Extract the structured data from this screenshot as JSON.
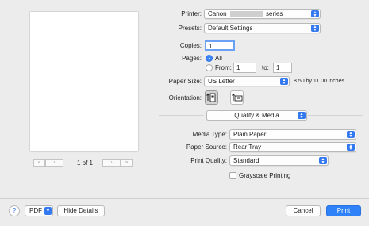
{
  "printer": {
    "label": "Printer:",
    "brand": "Canon",
    "model_suffix": "series",
    "redacted_icon": "redaction-block"
  },
  "presets": {
    "label": "Presets:",
    "value": "Default Settings"
  },
  "copies": {
    "label": "Copies:",
    "value": "1"
  },
  "pages": {
    "label": "Pages:",
    "all_label": "All",
    "from_label": "From:",
    "from_value": "1",
    "to_label": "to:",
    "to_value": "1",
    "selected": "All"
  },
  "paper_size": {
    "label": "Paper Size:",
    "value": "US Letter",
    "dimensions": "8.50 by 11.00 inches"
  },
  "orientation": {
    "label": "Orientation:",
    "selected": "portrait",
    "icons": [
      "portrait-orientation-icon",
      "landscape-orientation-icon"
    ]
  },
  "section": {
    "value": "Quality & Media"
  },
  "media_type": {
    "label": "Media Type:",
    "value": "Plain Paper"
  },
  "paper_source": {
    "label": "Paper Source:",
    "value": "Rear Tray"
  },
  "print_quality": {
    "label": "Print Quality:",
    "value": "Standard"
  },
  "grayscale": {
    "label": "Grayscale Printing",
    "checked": false
  },
  "preview_nav": {
    "page_indicator": "1 of 1",
    "first": "«",
    "prev": "‹",
    "next": "›",
    "last": "»"
  },
  "footer": {
    "help": "?",
    "pdf": "PDF",
    "hide_details": "Hide Details",
    "cancel": "Cancel",
    "print": "Print"
  },
  "colors": {
    "accent": "#3479f0",
    "window_bg": "#ececec",
    "primary_button": "#2f82f7"
  }
}
